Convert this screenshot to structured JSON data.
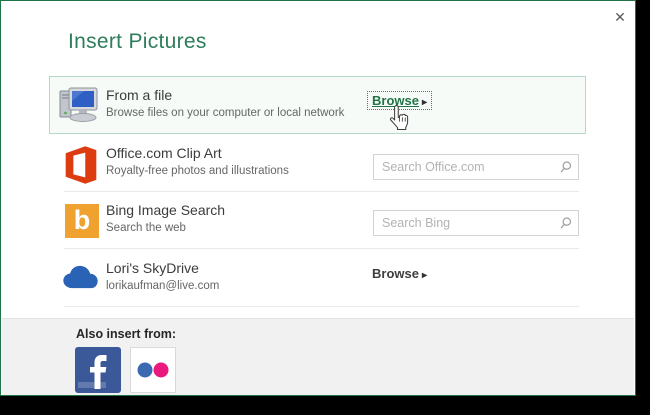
{
  "window": {
    "title": "Insert Pictures",
    "close_glyph": "✕"
  },
  "providers": [
    {
      "title": "From a file",
      "subtitle": "Browse files on your computer or local network",
      "browse_label": "Browse",
      "arrow": "▸",
      "icon": "computer-icon",
      "selected": true
    },
    {
      "title": "Office.com Clip Art",
      "subtitle": "Royalty-free photos and illustrations",
      "search_placeholder": "Search Office.com",
      "icon": "office-logo-icon"
    },
    {
      "title": "Bing Image Search",
      "subtitle": "Search the web",
      "search_placeholder": "Search Bing",
      "logo_glyph": "b",
      "icon": "bing-icon"
    },
    {
      "title": "Lori's SkyDrive",
      "subtitle": "lorikaufman@live.com",
      "browse_label": "Browse",
      "arrow": "▸",
      "icon": "skydrive-cloud-icon"
    }
  ],
  "footer": {
    "label": "Also insert from:",
    "services": [
      "Facebook",
      "Flickr"
    ]
  },
  "colors": {
    "accent_green": "#217346",
    "title_green": "#2e7d5b",
    "selected_row_border": "#b5d9c8",
    "selected_row_bg": "#f6fbf8",
    "office_orange": "#dd3b10",
    "bing_amber": "#f0a230",
    "skydrive_blue": "#2a63b6",
    "facebook_blue": "#3b5998",
    "flickr_blue": "#3b6ab3",
    "flickr_pink": "#e91a7c"
  }
}
